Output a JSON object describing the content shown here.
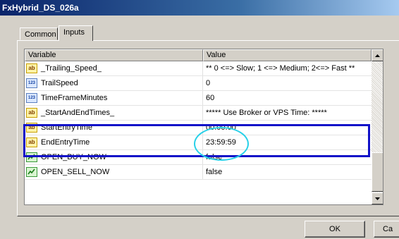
{
  "window": {
    "title": "FxHybrid_DS_026a"
  },
  "tabs": [
    {
      "label": "Common"
    },
    {
      "label": "Inputs"
    }
  ],
  "list": {
    "columns": {
      "variable": "Variable",
      "value": "Value"
    },
    "rows": [
      {
        "type": "ab",
        "name": "_Trailing_Speed_",
        "value": "** 0 <=> Slow; 1 <=> Medium; 2<=> Fast **"
      },
      {
        "type": "123",
        "name": "TrailSpeed",
        "value": "0"
      },
      {
        "type": "123",
        "name": "TimeFrameMinutes",
        "value": "60"
      },
      {
        "type": "ab",
        "name": "_StartAndEndTimes_",
        "value": "***** Use Broker or VPS Time: *****"
      },
      {
        "type": "ab",
        "name": "StartEntryTime",
        "value": "00:00:00"
      },
      {
        "type": "ab",
        "name": "EndEntryTime",
        "value": "23:59:59"
      },
      {
        "type": "bool",
        "name": "OPEN_BUY_NOW",
        "value": "false"
      },
      {
        "type": "bool",
        "name": "OPEN_SELL_NOW",
        "value": "false"
      }
    ]
  },
  "icons": {
    "ab": "ab",
    "num": "123"
  },
  "buttons": {
    "ok": "OK",
    "cancel": "Ca"
  },
  "colors": {
    "highlight_box": "#1212c8",
    "highlight_circle": "#27d0e8",
    "title_bar": "#0a246a"
  }
}
